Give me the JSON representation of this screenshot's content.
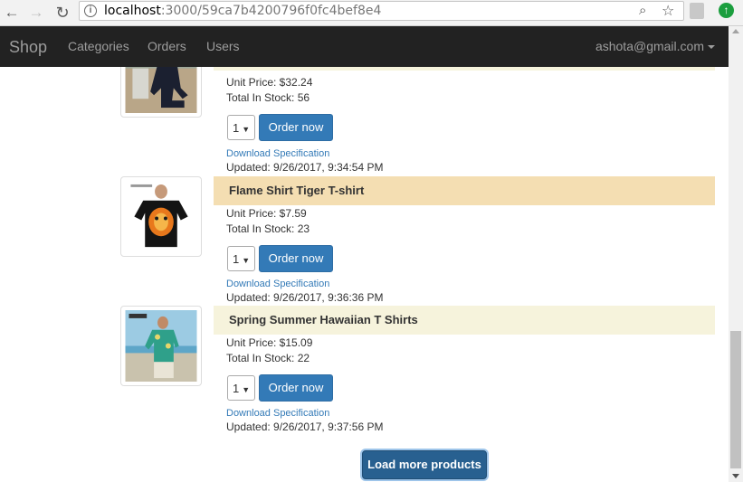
{
  "browser": {
    "url_host": "localhost",
    "url_path": ":3000/59ca7b4200796f0fc4bef8e4"
  },
  "navbar": {
    "brand": "Shop",
    "links": [
      "Categories",
      "Orders",
      "Users"
    ],
    "user_email": "ashota@gmail.com"
  },
  "products": [
    {
      "name": "",
      "title_color": "#f6f3dc",
      "unit_price": "Unit Price: $32.24",
      "stock": "Total In Stock: 56",
      "quantity": "1",
      "order_label": "Order now",
      "download_label": "Download Specification",
      "updated": "Updated: 9/26/2017, 9:34:54 PM"
    },
    {
      "name": "Flame Shirt Tiger T-shirt",
      "title_color": "#f4deb2",
      "unit_price": "Unit Price: $7.59",
      "stock": "Total In Stock: 23",
      "quantity": "1",
      "order_label": "Order now",
      "download_label": "Download Specification",
      "updated": "Updated: 9/26/2017, 9:36:36 PM"
    },
    {
      "name": "Spring Summer Hawaiian T Shirts",
      "title_color": "#f6f3dc",
      "unit_price": "Unit Price: $15.09",
      "stock": "Total In Stock: 22",
      "quantity": "1",
      "order_label": "Order now",
      "download_label": "Download Specification",
      "updated": "Updated: 9/26/2017, 9:37:56 PM"
    }
  ],
  "load_more_label": "Load more products",
  "icons": {
    "back": "arrow-left-icon",
    "forward": "arrow-right-icon",
    "reload": "reload-icon",
    "info": "info-icon",
    "zoom": "zoom-icon",
    "bookmark": "star-icon"
  }
}
